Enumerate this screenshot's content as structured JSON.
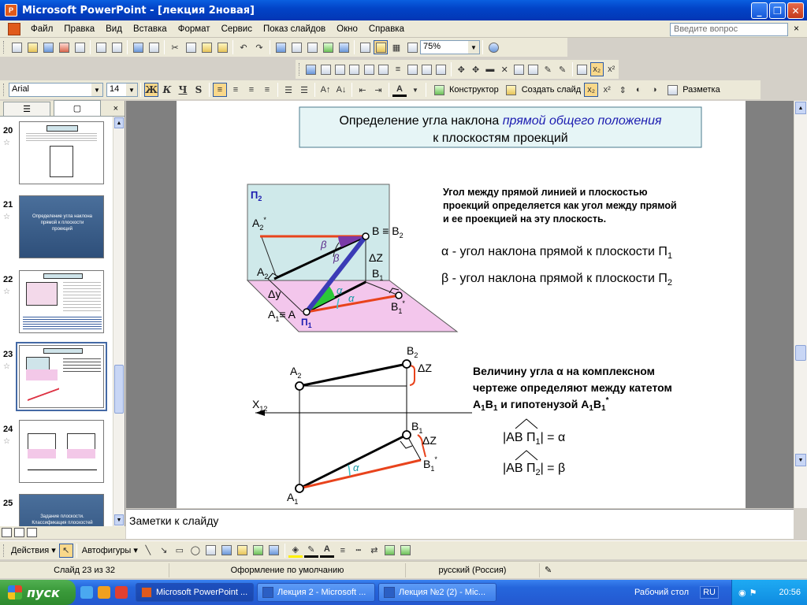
{
  "window": {
    "title": "Microsoft PowerPoint - [лекция 2новая]",
    "min": "_",
    "max": "❐",
    "close": "✕"
  },
  "menu": {
    "items": [
      "Файл",
      "Правка",
      "Вид",
      "Вставка",
      "Формат",
      "Сервис",
      "Показ слайдов",
      "Окно",
      "Справка"
    ],
    "help_placeholder": "Введите вопрос",
    "help_close": "×"
  },
  "toolbar_std": {
    "zoom": "75%"
  },
  "toolbar_fmt": {
    "font": "Arial",
    "size": "14",
    "bold": "Ж",
    "italic": "К",
    "underline": "Ч",
    "shadow": "S",
    "designer": "Конструктор",
    "new_slide": "Создать слайд",
    "layout": "Разметка",
    "subscript": "x₂",
    "superscript": "x²"
  },
  "left_pane": {
    "tab_close": "×",
    "slides": [
      {
        "num": "20"
      },
      {
        "num": "21",
        "text": "Определение угла наклона прямой к плоскости проекций"
      },
      {
        "num": "22"
      },
      {
        "num": "23"
      },
      {
        "num": "24"
      },
      {
        "num": "25",
        "text": "Задание плоскости. Классификация плоскостей"
      }
    ]
  },
  "slide": {
    "title_plain": "Определение угла  наклона ",
    "title_em": "прямой общего положения",
    "title_line2": "к плоскостям проекций",
    "def_lines": [
      "Угол между прямой линией и плоскостью",
      "проекций определяется как угол между прямой",
      "и ее проекцией на эту плоскость."
    ],
    "alpha_line": "α - угол наклона прямой к плоскости П",
    "alpha_sub": "1",
    "beta_line": "β - угол наклона прямой к плоскости П",
    "beta_sub": "2",
    "pi2": "П",
    "pi2_sub": "2",
    "pi1": "П",
    "pi1_sub": "1",
    "lbl_a2star": "A",
    "lbl_a2star_sub": "2",
    "lbl_a2star_sup": "*",
    "lbl_beq": "B ≡ B",
    "lbl_beq_sub": "2",
    "lbl_beta1": "β",
    "lbl_beta2": "β",
    "lbl_dz": "ΔZ",
    "lbl_a2": "A",
    "lbl_a2_sub": "2",
    "lbl_b1": "B",
    "lbl_b1_sub": "1",
    "lbl_dy": "Δy",
    "lbl_alpha1": "α",
    "lbl_alpha2": "α",
    "lbl_b1star": "B",
    "lbl_b1star_sub": "1",
    "lbl_b1star_sup": "*",
    "lbl_a1eq": "A",
    "lbl_a1eq_sub": "1",
    "lbl_a1eq_rest": "≡ A",
    "cd_b2": "B",
    "cd_b2_sub": "2",
    "cd_a2": "A",
    "cd_a2_sub": "2",
    "cd_dz": "ΔZ",
    "cd_x12": "X",
    "cd_x12_sub": "12",
    "cd_b1": "B",
    "cd_b1_sub": "1",
    "cd_dz2": "ΔZ",
    "cd_b1star": "B",
    "cd_b1star_sub": "1",
    "cd_b1star_sup": "*",
    "cd_alpha": "α",
    "cd_a1": "A",
    "cd_a1_sub": "1",
    "desc_line1": "Величину угла α на комплексном",
    "desc_line2": "чертеже определяют между катетом",
    "desc_line3_a": "A",
    "desc_line3_a_sub": "1",
    "desc_line3_b": "B",
    "desc_line3_b_sub": "1",
    "desc_line3_mid": "  и гипотенузой  A",
    "desc_line3_c_sub": "1",
    "desc_line3_d": "B",
    "desc_line3_d_sub": "1",
    "desc_line3_sup": "*",
    "f1_left": "|AB П",
    "f1_sub": "1",
    "f1_right": "|  =  α",
    "f2_left": "|AB П",
    "f2_sub": "2",
    "f2_right": "|  = β"
  },
  "notes": {
    "placeholder": "Заметки к слайду"
  },
  "drawbar": {
    "actions": "Действия",
    "autoshapes": "Автофигуры"
  },
  "status": {
    "slide": "Слайд 23 из 32",
    "design": "Оформление по умолчанию",
    "language": "русский (Россия)"
  },
  "taskbar": {
    "start": "пуск",
    "tasks": [
      "Microsoft PowerPoint ...",
      "Лекция 2 - Microsoft ...",
      "Лекция №2 (2) - Mic..."
    ],
    "desktop": "Рабочий стол",
    "lang": "RU",
    "time": "20:56"
  }
}
